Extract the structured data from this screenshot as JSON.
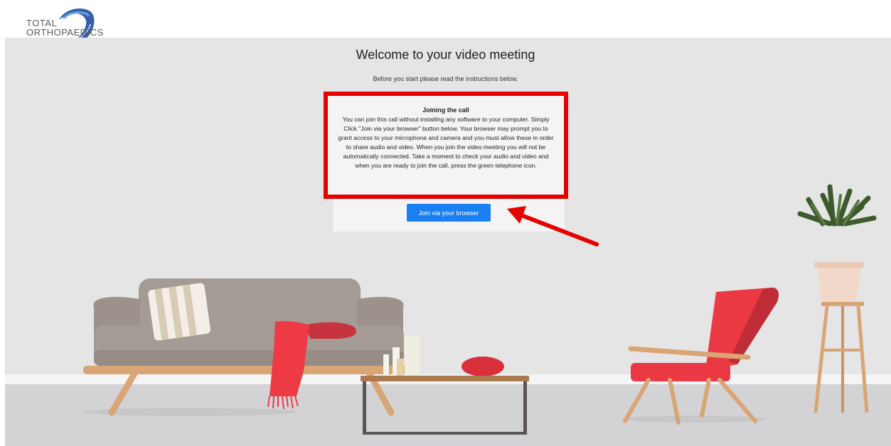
{
  "logo": {
    "line1": "TOTAL",
    "line2": "ORTHOPAEDICS"
  },
  "page": {
    "title": "Welcome to your video meeting",
    "subtitle": "Before you start please read the instructions below."
  },
  "instructions": {
    "title": "Joining the call",
    "body": "You can join this call without installing any software to your computer. Simply Click \"Join via your browser\" button below. Your browser may prompt you to grant access to your microphone and camera and you must allow these in order to share audio and video. When you join the video meeting you will not be automatically connected. Take a moment to check your audio and video and when you are ready to join the call, press the green telephone icon."
  },
  "join_button": {
    "label": "Join via your browser"
  },
  "colors": {
    "accent_blue": "#1a7ff0",
    "highlight_red": "#e60000",
    "background": "#e5e5e6"
  }
}
